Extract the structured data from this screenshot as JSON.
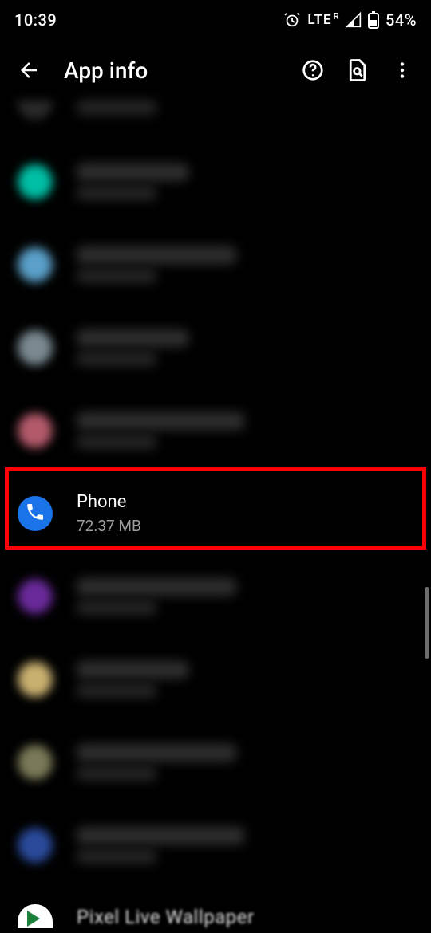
{
  "status": {
    "time": "10:39",
    "network": "LTE",
    "roaming": "R",
    "battery_pct": "54%"
  },
  "appbar": {
    "title": "App info"
  },
  "highlighted_app": {
    "name": "Phone",
    "size": "72.37 MB"
  },
  "last_visible": {
    "name": "Pixel Live Wallpaper"
  },
  "blur_rows": [
    {
      "id": "r0",
      "icon_bg": "#2a2a2a",
      "wide": false,
      "partial": "top"
    },
    {
      "id": "r1",
      "icon_bg": "#00bfa5",
      "wide": false
    },
    {
      "id": "r2",
      "icon_bg": "#5aa0c8",
      "wide": true
    },
    {
      "id": "r3",
      "icon_bg": "#7a8a90",
      "wide": false
    },
    {
      "id": "r4",
      "icon_bg": "#b35a6a",
      "wide": true
    },
    {
      "id": "r6",
      "icon_bg": "#6a2a9a",
      "wide": true
    },
    {
      "id": "r7",
      "icon_bg": "#c8b070",
      "wide": false
    },
    {
      "id": "r8",
      "icon_bg": "#7a7a58",
      "wide": true
    },
    {
      "id": "r9",
      "icon_bg": "#2a4a9a",
      "wide": true
    }
  ],
  "colors": {
    "accent": "#1a73e8",
    "highlight": "#ff0000",
    "subtext": "#9e9e9e"
  }
}
